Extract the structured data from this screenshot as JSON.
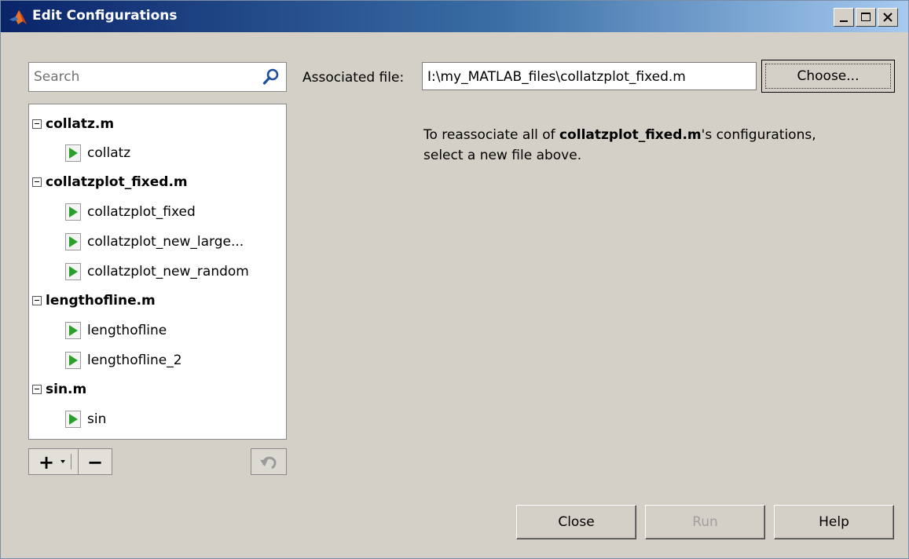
{
  "window": {
    "title": "Edit Configurations"
  },
  "search": {
    "placeholder": "Search",
    "value": ""
  },
  "tree": {
    "groups": [
      {
        "label": "collatz.m",
        "items": [
          "collatz"
        ]
      },
      {
        "label": "collatzplot_fixed.m",
        "items": [
          "collatzplot_fixed",
          "collatzplot_new_large...",
          "collatzplot_new_random"
        ]
      },
      {
        "label": "lengthofline.m",
        "items": [
          "lengthofline",
          "lengthofline_2"
        ]
      },
      {
        "label": "sin.m",
        "items": [
          "sin"
        ]
      }
    ]
  },
  "toolbar": {
    "add_label": "+",
    "remove_label": "−"
  },
  "associated": {
    "label": "Associated file:",
    "value": "I:\\my_MATLAB_files\\collatzplot_fixed.m",
    "choose_label": "Choose..."
  },
  "info": {
    "prefix": "To reassociate all of ",
    "filename": "collatzplot_fixed.m",
    "suffix": "'s configurations,",
    "line2": "select a new file above."
  },
  "buttons": {
    "close": "Close",
    "run": "Run",
    "help": "Help"
  },
  "colors": {
    "title_start": "#0a246a",
    "title_end": "#a6caf0",
    "dialog_bg": "#d4d0c8",
    "run_icon": "#2aa02a"
  }
}
